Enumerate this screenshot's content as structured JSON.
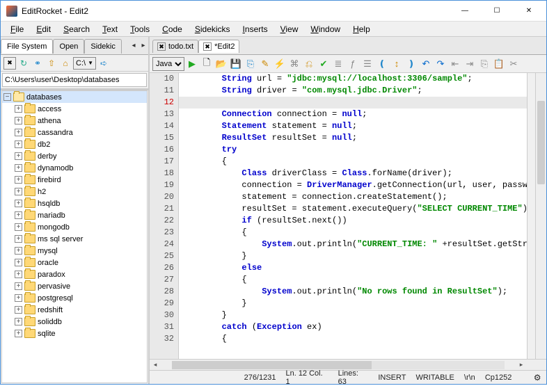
{
  "app": {
    "title": "EditRocket - Edit2"
  },
  "winbtns": {
    "min": "—",
    "max": "☐",
    "close": "✕"
  },
  "menu": [
    "File",
    "Edit",
    "Search",
    "Text",
    "Tools",
    "Code",
    "Sidekicks",
    "Inserts",
    "View",
    "Window",
    "Help"
  ],
  "sidetabs": {
    "items": [
      "File System",
      "Open",
      "Sidekic"
    ],
    "active": 0
  },
  "fs": {
    "drive": "C:\\",
    "path": "C:\\Users\\user\\Desktop\\databases",
    "root": "databases",
    "children": [
      "access",
      "athena",
      "cassandra",
      "db2",
      "derby",
      "dynamodb",
      "firebird",
      "h2",
      "hsqldb",
      "mariadb",
      "mongodb",
      "ms sql server",
      "mysql",
      "oracle",
      "paradox",
      "pervasive",
      "postgresql",
      "redshift",
      "soliddb",
      "sqlite"
    ]
  },
  "tabs": {
    "items": [
      "todo.txt",
      "*Edit2"
    ],
    "active": 1
  },
  "lang": {
    "selected": "Java"
  },
  "code": {
    "first_line": 10,
    "current_line": 12,
    "lines": [
      [
        [
          "kw",
          "String"
        ],
        [
          "",
          " url = "
        ],
        [
          "st",
          "\"jdbc:mysql://localhost:3306/sample\""
        ],
        [
          "",
          ";"
        ]
      ],
      [
        [
          "kw",
          "String"
        ],
        [
          "",
          " driver = "
        ],
        [
          "st",
          "\"com.mysql.jdbc.Driver\""
        ],
        [
          "",
          ";"
        ]
      ],
      [
        [
          "",
          ""
        ]
      ],
      [
        [
          "kw",
          "Connection"
        ],
        [
          "",
          " connection = "
        ],
        [
          "kw",
          "null"
        ],
        [
          "",
          ";"
        ]
      ],
      [
        [
          "kw",
          "Statement"
        ],
        [
          "",
          " statement = "
        ],
        [
          "kw",
          "null"
        ],
        [
          "",
          ";"
        ]
      ],
      [
        [
          "kw",
          "ResultSet"
        ],
        [
          "",
          " resultSet = "
        ],
        [
          "kw",
          "null"
        ],
        [
          "",
          ";"
        ]
      ],
      [
        [
          "kw",
          "try"
        ]
      ],
      [
        [
          "",
          "{"
        ]
      ],
      [
        [
          "",
          "    "
        ],
        [
          "kw",
          "Class"
        ],
        [
          "",
          " driverClass = "
        ],
        [
          "kw",
          "Class"
        ],
        [
          "",
          ".forName(driver);"
        ]
      ],
      [
        [
          "",
          "    connection = "
        ],
        [
          "kw",
          "DriverManager"
        ],
        [
          "",
          ".getConnection(url, user, passwor"
        ]
      ],
      [
        [
          "",
          "    statement = connection.createStatement();"
        ]
      ],
      [
        [
          "",
          "    resultSet = statement.executeQuery("
        ],
        [
          "st",
          "\"SELECT CURRENT_TIME\""
        ],
        [
          "",
          ");"
        ]
      ],
      [
        [
          "",
          "    "
        ],
        [
          "kw",
          "if"
        ],
        [
          "",
          " (resultSet.next())"
        ]
      ],
      [
        [
          "",
          "    {"
        ]
      ],
      [
        [
          "",
          "        "
        ],
        [
          "kw",
          "System"
        ],
        [
          "",
          ".out.println("
        ],
        [
          "st",
          "\"CURRENT_TIME: \""
        ],
        [
          "",
          " +resultSet.getStrin"
        ]
      ],
      [
        [
          "",
          "    }"
        ]
      ],
      [
        [
          "",
          "    "
        ],
        [
          "kw",
          "else"
        ]
      ],
      [
        [
          "",
          "    {"
        ]
      ],
      [
        [
          "",
          "        "
        ],
        [
          "kw",
          "System"
        ],
        [
          "",
          ".out.println("
        ],
        [
          "st",
          "\"No rows found in ResultSet\""
        ],
        [
          "",
          ");"
        ]
      ],
      [
        [
          "",
          "    }"
        ]
      ],
      [
        [
          "",
          "}"
        ]
      ],
      [
        [
          "kw",
          "catch"
        ],
        [
          "",
          " ("
        ],
        [
          "kw",
          "Exception"
        ],
        [
          "",
          " ex)"
        ]
      ],
      [
        [
          "",
          "{"
        ]
      ]
    ],
    "base_indent": "        "
  },
  "status": {
    "pos": "276/1231",
    "lncol": "Ln. 12 Col. 1",
    "lines": "Lines: 63",
    "insert": "INSERT",
    "writable": "WRITABLE",
    "eol": "\\r\\n",
    "enc": "Cp1252"
  }
}
